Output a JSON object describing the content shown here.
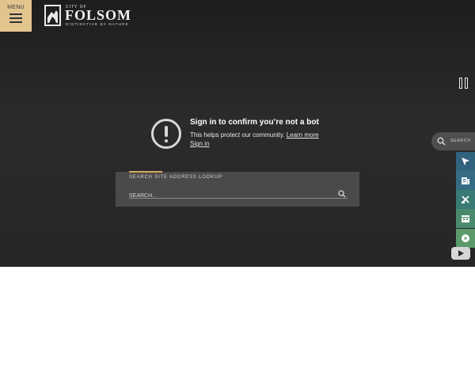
{
  "header": {
    "menu_label": "MENU",
    "logo": {
      "city_of": "CITY OF",
      "name": "FOLSOM",
      "tagline": "DISTINCTIVE BY NATURE"
    }
  },
  "bot_notice": {
    "title": "Sign in to confirm you’re not a bot",
    "body": "This helps protect our community.",
    "learn_more": "Learn more",
    "sign_in": "Sign in"
  },
  "search_panel": {
    "tabs": [
      "SEARCH SITE",
      "ADDRESS LOOKUP"
    ],
    "active_tab": "SEARCH SITE",
    "placeholder": "SEARCH..."
  },
  "side_search": {
    "label": "SEARCH"
  },
  "colors": {
    "menu_bg": "#e2c48e",
    "tab_accent": "#d2a663",
    "quick_links": [
      "#31627e",
      "#356b84",
      "#3a7a74",
      "#4a8a6c",
      "#5b9a6a"
    ]
  },
  "icons": [
    "menu-icon",
    "pause-icon",
    "alert-icon",
    "search-icon",
    "pointer-icon",
    "news-icon",
    "tools-icon",
    "calendar-icon",
    "play-icon",
    "youtube-icon"
  ]
}
